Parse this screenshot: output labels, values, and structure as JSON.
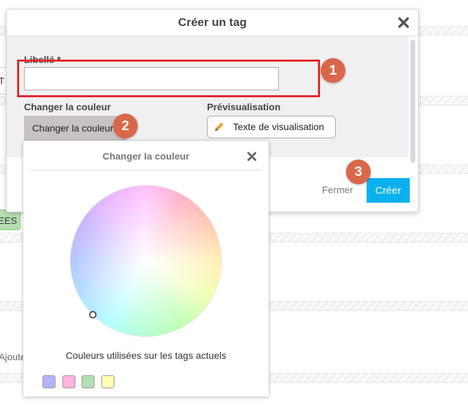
{
  "background": {
    "input_value": "T",
    "tag_label": "EES",
    "side_text": "Ajoute"
  },
  "modal": {
    "title": "Créer un tag",
    "libelle_label": "Libellé *",
    "libelle_value": "",
    "change_color_label": "Changer la couleur",
    "change_color_button": "Changer la couleur",
    "preview_label": "Prévisualisation",
    "preview_tag_text": "Texte de visualisation",
    "close_label": "Fermer",
    "create_label": "Créer"
  },
  "badges": [
    "1",
    "2",
    "3"
  ],
  "color_picker": {
    "title": "Changer la couleur",
    "caption": "Couleurs utilisées sur les tags actuels",
    "swatches": [
      "#b3b3f5",
      "#ffb3e0",
      "#b3ddb3",
      "#ffffb3"
    ]
  },
  "colors": {
    "primary": "#0bb1ef",
    "badge": "#d9674a",
    "highlight": "#e5262b"
  }
}
